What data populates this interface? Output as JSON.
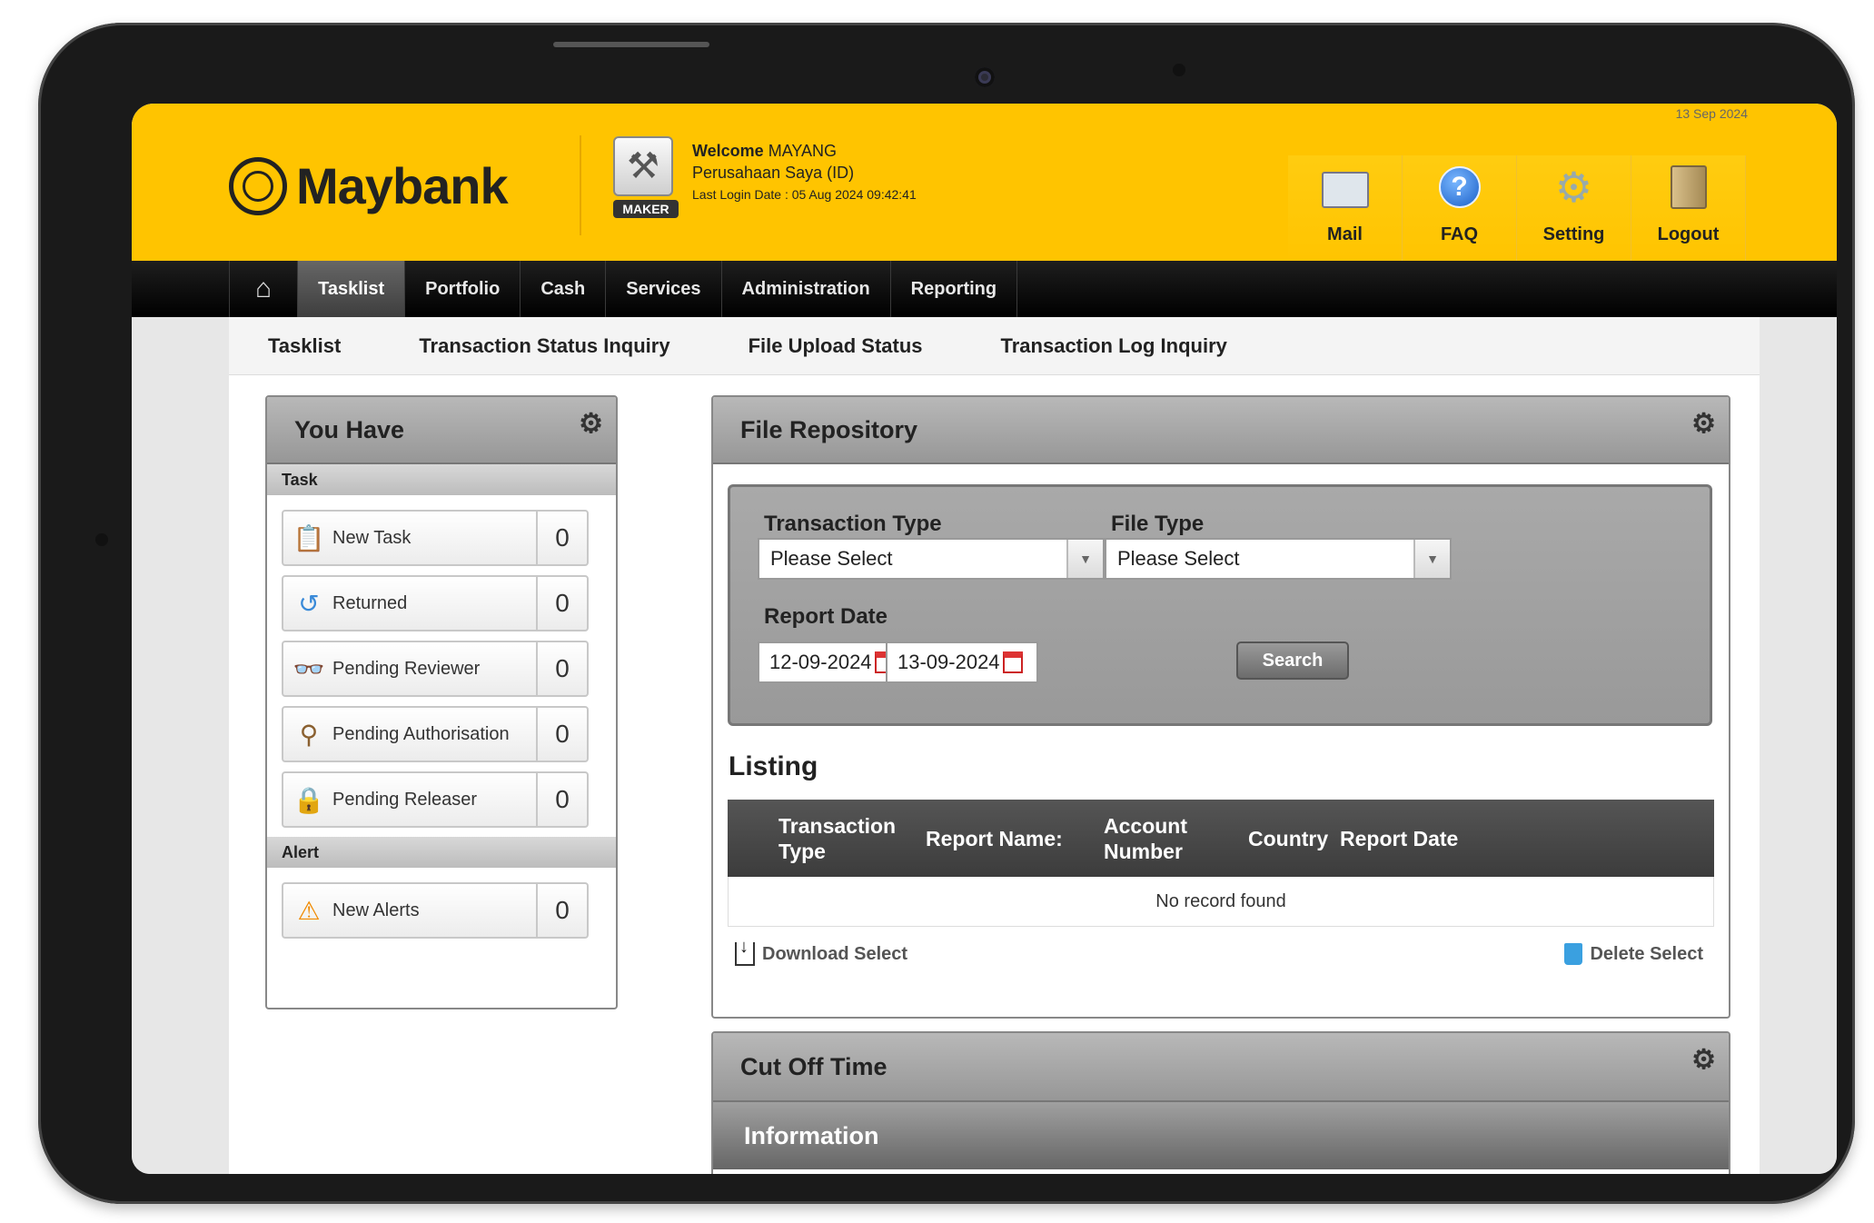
{
  "header": {
    "date": "13 Sep 2024",
    "brand": "Maybank",
    "role_tag": "MAKER",
    "welcome_label": "Welcome",
    "user_name": "MAYANG",
    "company": "Perusahaan Saya (ID)",
    "last_login": "Last Login Date : 05 Aug 2024 09:42:41",
    "nav": [
      {
        "label": "Mail",
        "icon": "mail-icon"
      },
      {
        "label": "FAQ",
        "icon": "faq-icon"
      },
      {
        "label": "Setting",
        "icon": "gear-icon"
      },
      {
        "label": "Logout",
        "icon": "logout-icon"
      }
    ]
  },
  "mainnav": {
    "home_icon": "home-icon",
    "items": [
      "Tasklist",
      "Portfolio",
      "Cash",
      "Services",
      "Administration",
      "Reporting"
    ],
    "active": "Tasklist"
  },
  "subnav": {
    "items": [
      "Tasklist",
      "Transaction Status Inquiry",
      "File Upload Status",
      "Transaction Log Inquiry"
    ]
  },
  "you_have": {
    "title": "You Have",
    "task_section": "Task",
    "tasks": [
      {
        "label": "New Task",
        "count": "0",
        "icon": "new-task-icon"
      },
      {
        "label": "Returned",
        "count": "0",
        "icon": "returned-icon"
      },
      {
        "label": "Pending Reviewer",
        "count": "0",
        "icon": "reviewer-icon"
      },
      {
        "label": "Pending Authorisation",
        "count": "0",
        "icon": "stamp-icon"
      },
      {
        "label": "Pending Releaser",
        "count": "0",
        "icon": "lock-icon"
      }
    ],
    "alert_section": "Alert",
    "alerts": [
      {
        "label": "New Alerts",
        "count": "0",
        "icon": "warning-icon"
      }
    ]
  },
  "file_repository": {
    "title": "File Repository",
    "transaction_type_label": "Transaction Type",
    "transaction_type_value": "Please Select",
    "file_type_label": "File Type",
    "file_type_value": "Please Select",
    "report_date_label": "Report Date",
    "date_from": "12-09-2024",
    "date_to": "13-09-2024",
    "search_label": "Search",
    "listing_title": "Listing",
    "columns": [
      "Transaction Type",
      "Report Name:",
      "Account Number",
      "Country",
      "Report Date"
    ],
    "empty_text": "No record found",
    "download_label": "Download Select",
    "delete_label": "Delete Select"
  },
  "cut_off": {
    "title": "Cut Off Time",
    "info_label": "Information"
  }
}
